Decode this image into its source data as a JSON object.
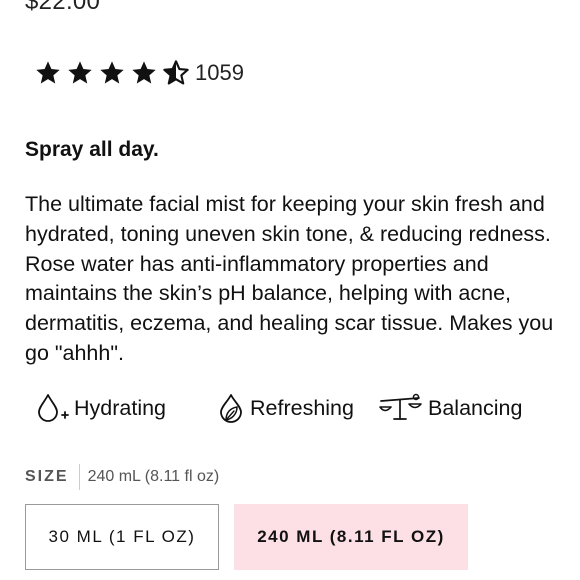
{
  "product": {
    "price": "$22.00",
    "rating_value": 4.5,
    "rating_max": 5,
    "review_count": "1059",
    "tagline": "Spray all day.",
    "description": "The ultimate facial mist for keeping your skin fresh and hydrated, toning uneven skin tone, & reducing redness. Rose water has anti-inflammatory properties and maintains the skin’s pH balance, helping with acne, dermatitis, eczema, and healing scar tissue. Makes you go \"ahhh\".",
    "benefits": [
      {
        "icon": "water-drop-plus-icon",
        "label": "Hydrating"
      },
      {
        "icon": "drop-leaf-icon",
        "label": "Refreshing"
      },
      {
        "icon": "balance-scale-icon",
        "label": "Balancing"
      }
    ]
  },
  "size": {
    "label": "SIZE",
    "selected_text": "240 mL (8.11 fl oz)",
    "options": [
      {
        "label": "30 ML (1 FL OZ)",
        "selected": false
      },
      {
        "label": "240 ML (8.11 FL OZ)",
        "selected": true
      }
    ]
  },
  "colors": {
    "selected_option_bg": "#fde0e6",
    "option_border": "#9a9a9a",
    "text": "#111111"
  }
}
